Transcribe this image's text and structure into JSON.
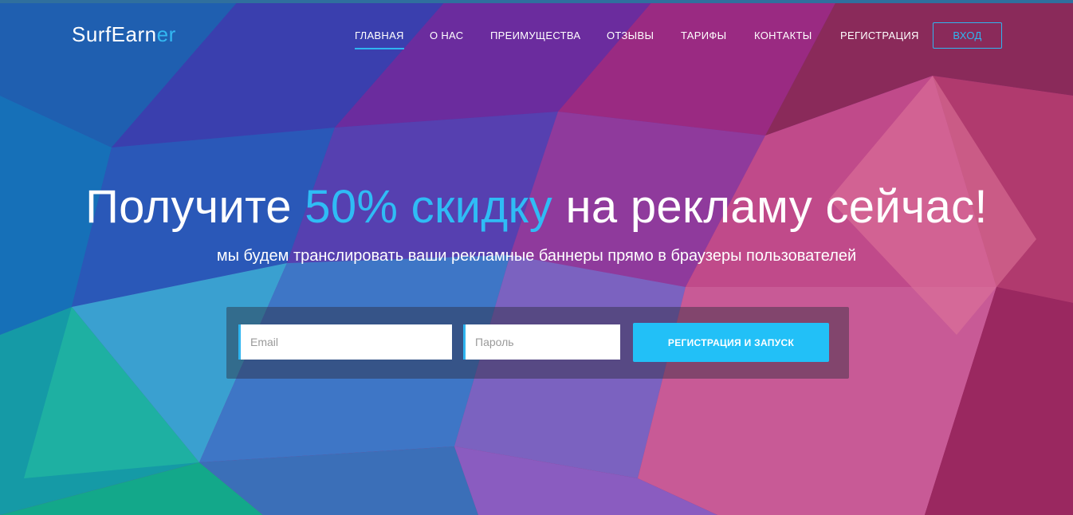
{
  "brand": {
    "name_main": "SurfEarn",
    "name_accent": "er"
  },
  "nav": {
    "items": [
      {
        "label": "ГЛАВНАЯ",
        "active": true
      },
      {
        "label": "О НАС",
        "active": false
      },
      {
        "label": "ПРЕИМУЩЕСТВА",
        "active": false
      },
      {
        "label": "ОТЗЫВЫ",
        "active": false
      },
      {
        "label": "ТАРИФЫ",
        "active": false
      },
      {
        "label": "КОНТАКТЫ",
        "active": false
      },
      {
        "label": "РЕГИСТРАЦИЯ",
        "active": false
      }
    ],
    "login_label": "ВХОД"
  },
  "hero": {
    "title_start": "Получите ",
    "title_accent": "50% скидку",
    "title_end": " на рекламу сейчас!",
    "subtitle": "мы будем транслировать ваши рекламные баннеры прямо в браузеры пользователей"
  },
  "form": {
    "email_placeholder": "Email",
    "email_value": "",
    "password_placeholder": "Пароль",
    "password_value": "",
    "submit_label": "РЕГИСТРАЦИЯ И ЗАПУСК"
  },
  "colors": {
    "accent": "#2fb5f0",
    "button": "#22c0f7",
    "text": "#ffffff"
  }
}
